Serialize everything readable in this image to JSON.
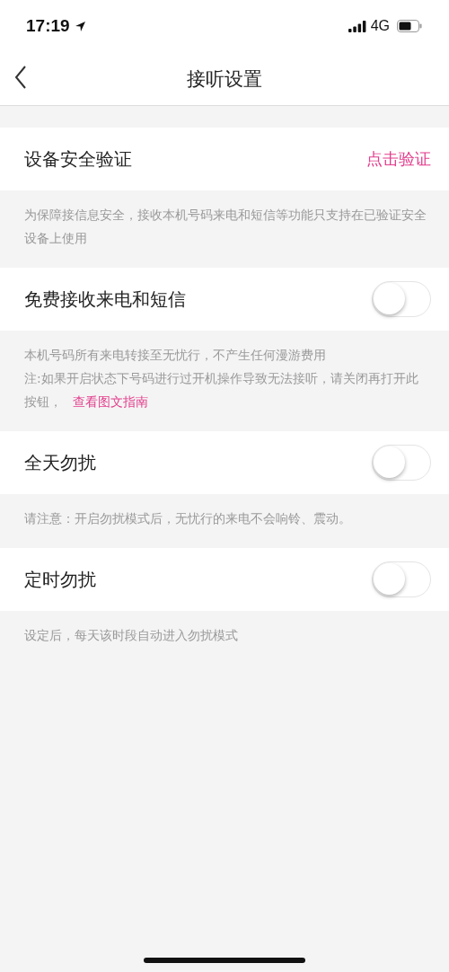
{
  "status_bar": {
    "time": "17:19",
    "network": "4G"
  },
  "nav": {
    "title": "接听设置"
  },
  "sections": [
    {
      "row": {
        "kind": "action",
        "label": "设备安全验证",
        "action": "点击验证"
      },
      "note": [
        {
          "text": "为保障接信息安全，接收本机号码来电和短信等功能只支持在已验证安全设备上使用"
        }
      ]
    },
    {
      "row": {
        "kind": "toggle",
        "label": "免费接收来电和短信",
        "on": false
      },
      "note": [
        {
          "text": "本机号码所有来电转接至无忧行，不产生任何漫游费用"
        },
        {
          "text": "注:如果开启状态下号码进行过开机操作导致无法接听，请关闭再打开此按钮，",
          "link": "查看图文指南"
        }
      ]
    },
    {
      "row": {
        "kind": "toggle",
        "label": "全天勿扰",
        "on": false
      },
      "note": [
        {
          "text": "请注意：开启勿扰模式后，无忧行的来电不会响铃、震动。"
        }
      ]
    },
    {
      "row": {
        "kind": "toggle",
        "label": "定时勿扰",
        "on": false
      },
      "note": [
        {
          "text": "设定后，每天该时段自动进入勿扰模式"
        }
      ]
    }
  ]
}
